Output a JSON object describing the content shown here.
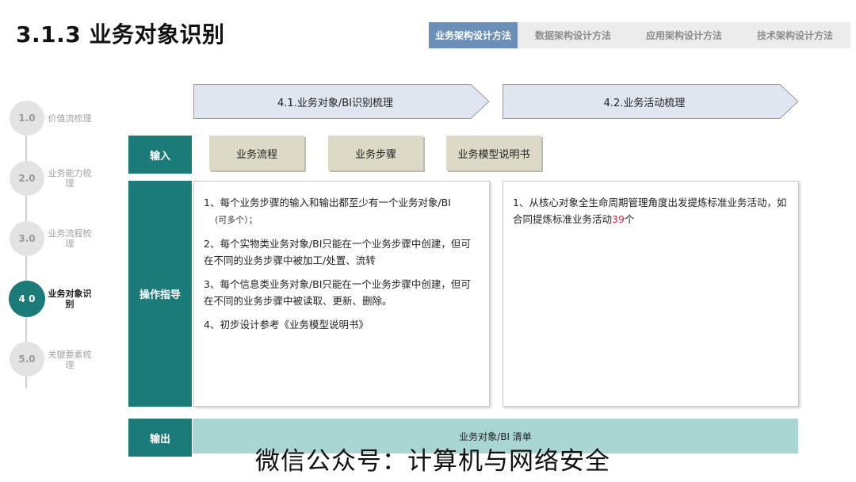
{
  "page_title": "3.1.3 业务对象识别",
  "tabs": [
    {
      "label": "业务架构设计方法",
      "active": true
    },
    {
      "label": "数据架构设计方法",
      "active": false
    },
    {
      "label": "应用架构设计方法",
      "active": false
    },
    {
      "label": "技术架构设计方法",
      "active": false
    }
  ],
  "timeline": [
    {
      "num": "1.0",
      "label": "价值流梳理"
    },
    {
      "num": "2.0",
      "label": "业务能力梳理"
    },
    {
      "num": "3.0",
      "label": "业务流程梳理"
    },
    {
      "num": "4 0",
      "label": "业务对象识别"
    },
    {
      "num": "5.0",
      "label": "关键要素梳理"
    }
  ],
  "arrows": [
    "4.1.业务对象/BI识别梳理",
    "4.2.业务活动梳理"
  ],
  "rows": {
    "input": "输入",
    "guide": "操作指导",
    "output": "输出"
  },
  "inputs": [
    "业务流程",
    "业务步骤",
    "业务模型说明书"
  ],
  "guide_left": {
    "item1": "1、每个业务步骤的输入和输出都至少有一个业务对象/BI",
    "item1_note": "(可多个）；",
    "item2": "2、每个实物类业务对象/BI只能在一个业务步骤中创建，但可在不同的业务步骤中被加工/处置、流转",
    "item3": "3、每个信息类业务对象/BI只能在一个业务步骤中创建，但可在不同的业务步骤中被读取、更新、删除。",
    "item4": "4、初步设计参考《业务模型说明书》"
  },
  "guide_right": {
    "prefix": "1、从核心对象全生命周期管理角度出发提炼标准业务活动，如合同提炼标准业务活动",
    "count": "39",
    "suffix": "个"
  },
  "output_text": "业务对象/BI 清单",
  "watermark": "微信公众号：计算机与网络安全",
  "colors": {
    "teal": "#1b7b78",
    "tab_active": "#6b8fb7",
    "arrow_fill": "#dfe6f0",
    "input_chip": "#dcd9c6",
    "output_bar": "#a9d5d3",
    "highlight": "#d9263b"
  }
}
